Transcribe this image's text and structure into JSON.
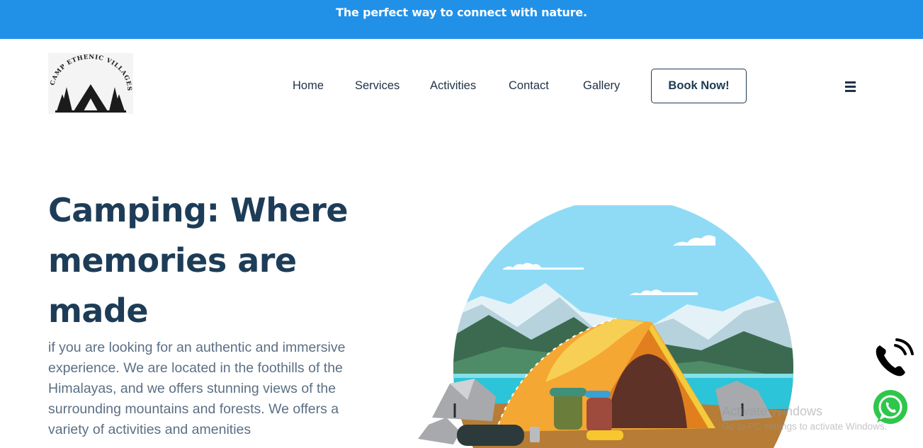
{
  "announcement": {
    "text": "The perfect way to connect with nature."
  },
  "logo": {
    "text": "CAMP ETHENIC VILLAGES",
    "icon": "tent-trees-icon"
  },
  "nav": {
    "items": [
      {
        "label": "Home"
      },
      {
        "label": "Services"
      },
      {
        "label": "Activities"
      },
      {
        "label": "Contact"
      },
      {
        "label": "Gallery"
      }
    ],
    "book_label": "Book Now!",
    "menu_icon": "hamburger-icon"
  },
  "hero": {
    "title": "Camping: Where memories are made",
    "description": "if you are looking for an authentic and immersive experience. We are located in the foothills of the Himalayas, and we offers stunning views of the surrounding mountains and forests. We offers a variety of activities and amenities"
  },
  "floating": {
    "phone_icon": "phone-ringing-icon",
    "whatsapp_icon": "whatsapp-icon"
  },
  "watermark": {
    "line1": "Activate Windows",
    "line2": "Go to PC settings to activate Windows."
  },
  "colors": {
    "accent": "#2191e8",
    "heading": "#1d3c57",
    "body_text": "#5c6f84",
    "nav_text": "#1f3246"
  }
}
